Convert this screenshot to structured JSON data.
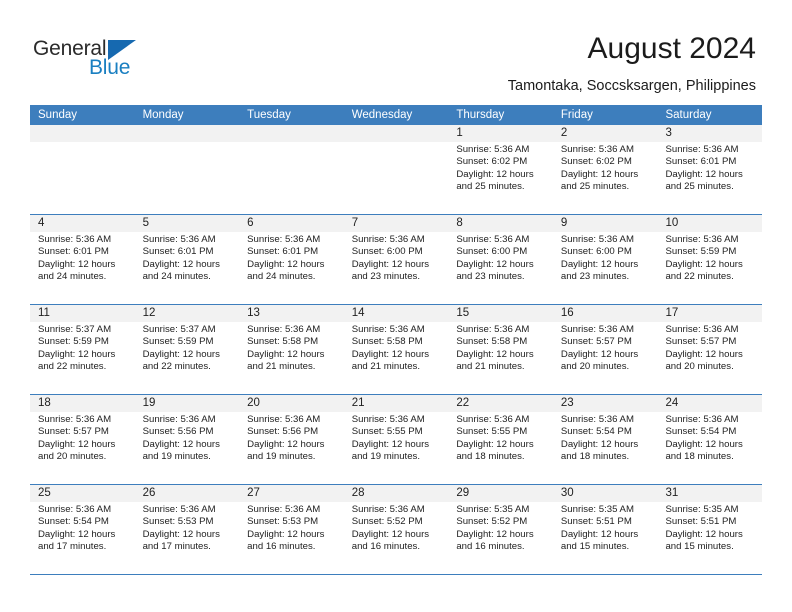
{
  "brand": {
    "name_part1": "General",
    "name_part2": "Blue",
    "accent_color": "#1a7fc1",
    "triangle_color": "#1669b0"
  },
  "header": {
    "title": "August 2024",
    "subtitle": "Tamontaka, Soccsksargen, Philippines"
  },
  "calendar": {
    "header_color": "#3d7ebd",
    "day_band_color": "#f2f2f2",
    "weekdays": [
      "Sunday",
      "Monday",
      "Tuesday",
      "Wednesday",
      "Thursday",
      "Friday",
      "Saturday"
    ],
    "weeks": [
      [
        {
          "day": "",
          "sunrise": "",
          "sunset": "",
          "daylight": "",
          "empty": true
        },
        {
          "day": "",
          "sunrise": "",
          "sunset": "",
          "daylight": "",
          "empty": true
        },
        {
          "day": "",
          "sunrise": "",
          "sunset": "",
          "daylight": "",
          "empty": true
        },
        {
          "day": "",
          "sunrise": "",
          "sunset": "",
          "daylight": "",
          "empty": true
        },
        {
          "day": "1",
          "sunrise": "Sunrise: 5:36 AM",
          "sunset": "Sunset: 6:02 PM",
          "daylight": "Daylight: 12 hours and 25 minutes.",
          "empty": false
        },
        {
          "day": "2",
          "sunrise": "Sunrise: 5:36 AM",
          "sunset": "Sunset: 6:02 PM",
          "daylight": "Daylight: 12 hours and 25 minutes.",
          "empty": false
        },
        {
          "day": "3",
          "sunrise": "Sunrise: 5:36 AM",
          "sunset": "Sunset: 6:01 PM",
          "daylight": "Daylight: 12 hours and 25 minutes.",
          "empty": false
        }
      ],
      [
        {
          "day": "4",
          "sunrise": "Sunrise: 5:36 AM",
          "sunset": "Sunset: 6:01 PM",
          "daylight": "Daylight: 12 hours and 24 minutes.",
          "empty": false
        },
        {
          "day": "5",
          "sunrise": "Sunrise: 5:36 AM",
          "sunset": "Sunset: 6:01 PM",
          "daylight": "Daylight: 12 hours and 24 minutes.",
          "empty": false
        },
        {
          "day": "6",
          "sunrise": "Sunrise: 5:36 AM",
          "sunset": "Sunset: 6:01 PM",
          "daylight": "Daylight: 12 hours and 24 minutes.",
          "empty": false
        },
        {
          "day": "7",
          "sunrise": "Sunrise: 5:36 AM",
          "sunset": "Sunset: 6:00 PM",
          "daylight": "Daylight: 12 hours and 23 minutes.",
          "empty": false
        },
        {
          "day": "8",
          "sunrise": "Sunrise: 5:36 AM",
          "sunset": "Sunset: 6:00 PM",
          "daylight": "Daylight: 12 hours and 23 minutes.",
          "empty": false
        },
        {
          "day": "9",
          "sunrise": "Sunrise: 5:36 AM",
          "sunset": "Sunset: 6:00 PM",
          "daylight": "Daylight: 12 hours and 23 minutes.",
          "empty": false
        },
        {
          "day": "10",
          "sunrise": "Sunrise: 5:36 AM",
          "sunset": "Sunset: 5:59 PM",
          "daylight": "Daylight: 12 hours and 22 minutes.",
          "empty": false
        }
      ],
      [
        {
          "day": "11",
          "sunrise": "Sunrise: 5:37 AM",
          "sunset": "Sunset: 5:59 PM",
          "daylight": "Daylight: 12 hours and 22 minutes.",
          "empty": false
        },
        {
          "day": "12",
          "sunrise": "Sunrise: 5:37 AM",
          "sunset": "Sunset: 5:59 PM",
          "daylight": "Daylight: 12 hours and 22 minutes.",
          "empty": false
        },
        {
          "day": "13",
          "sunrise": "Sunrise: 5:36 AM",
          "sunset": "Sunset: 5:58 PM",
          "daylight": "Daylight: 12 hours and 21 minutes.",
          "empty": false
        },
        {
          "day": "14",
          "sunrise": "Sunrise: 5:36 AM",
          "sunset": "Sunset: 5:58 PM",
          "daylight": "Daylight: 12 hours and 21 minutes.",
          "empty": false
        },
        {
          "day": "15",
          "sunrise": "Sunrise: 5:36 AM",
          "sunset": "Sunset: 5:58 PM",
          "daylight": "Daylight: 12 hours and 21 minutes.",
          "empty": false
        },
        {
          "day": "16",
          "sunrise": "Sunrise: 5:36 AM",
          "sunset": "Sunset: 5:57 PM",
          "daylight": "Daylight: 12 hours and 20 minutes.",
          "empty": false
        },
        {
          "day": "17",
          "sunrise": "Sunrise: 5:36 AM",
          "sunset": "Sunset: 5:57 PM",
          "daylight": "Daylight: 12 hours and 20 minutes.",
          "empty": false
        }
      ],
      [
        {
          "day": "18",
          "sunrise": "Sunrise: 5:36 AM",
          "sunset": "Sunset: 5:57 PM",
          "daylight": "Daylight: 12 hours and 20 minutes.",
          "empty": false
        },
        {
          "day": "19",
          "sunrise": "Sunrise: 5:36 AM",
          "sunset": "Sunset: 5:56 PM",
          "daylight": "Daylight: 12 hours and 19 minutes.",
          "empty": false
        },
        {
          "day": "20",
          "sunrise": "Sunrise: 5:36 AM",
          "sunset": "Sunset: 5:56 PM",
          "daylight": "Daylight: 12 hours and 19 minutes.",
          "empty": false
        },
        {
          "day": "21",
          "sunrise": "Sunrise: 5:36 AM",
          "sunset": "Sunset: 5:55 PM",
          "daylight": "Daylight: 12 hours and 19 minutes.",
          "empty": false
        },
        {
          "day": "22",
          "sunrise": "Sunrise: 5:36 AM",
          "sunset": "Sunset: 5:55 PM",
          "daylight": "Daylight: 12 hours and 18 minutes.",
          "empty": false
        },
        {
          "day": "23",
          "sunrise": "Sunrise: 5:36 AM",
          "sunset": "Sunset: 5:54 PM",
          "daylight": "Daylight: 12 hours and 18 minutes.",
          "empty": false
        },
        {
          "day": "24",
          "sunrise": "Sunrise: 5:36 AM",
          "sunset": "Sunset: 5:54 PM",
          "daylight": "Daylight: 12 hours and 18 minutes.",
          "empty": false
        }
      ],
      [
        {
          "day": "25",
          "sunrise": "Sunrise: 5:36 AM",
          "sunset": "Sunset: 5:54 PM",
          "daylight": "Daylight: 12 hours and 17 minutes.",
          "empty": false
        },
        {
          "day": "26",
          "sunrise": "Sunrise: 5:36 AM",
          "sunset": "Sunset: 5:53 PM",
          "daylight": "Daylight: 12 hours and 17 minutes.",
          "empty": false
        },
        {
          "day": "27",
          "sunrise": "Sunrise: 5:36 AM",
          "sunset": "Sunset: 5:53 PM",
          "daylight": "Daylight: 12 hours and 16 minutes.",
          "empty": false
        },
        {
          "day": "28",
          "sunrise": "Sunrise: 5:36 AM",
          "sunset": "Sunset: 5:52 PM",
          "daylight": "Daylight: 12 hours and 16 minutes.",
          "empty": false
        },
        {
          "day": "29",
          "sunrise": "Sunrise: 5:35 AM",
          "sunset": "Sunset: 5:52 PM",
          "daylight": "Daylight: 12 hours and 16 minutes.",
          "empty": false
        },
        {
          "day": "30",
          "sunrise": "Sunrise: 5:35 AM",
          "sunset": "Sunset: 5:51 PM",
          "daylight": "Daylight: 12 hours and 15 minutes.",
          "empty": false
        },
        {
          "day": "31",
          "sunrise": "Sunrise: 5:35 AM",
          "sunset": "Sunset: 5:51 PM",
          "daylight": "Daylight: 12 hours and 15 minutes.",
          "empty": false
        }
      ]
    ]
  }
}
